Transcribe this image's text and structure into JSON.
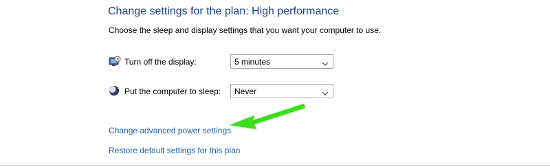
{
  "header": {
    "title": "Change settings for the plan: High performance",
    "subtitle": "Choose the sleep and display settings that you want your computer to use."
  },
  "settings": [
    {
      "icon": "monitor-clock-icon",
      "label": "Turn off the display:",
      "value": "5 minutes"
    },
    {
      "icon": "moon-sleep-icon",
      "label": "Put the computer to sleep:",
      "value": "Never"
    }
  ],
  "links": {
    "advanced": "Change advanced power settings",
    "restore": "Restore default settings for this plan"
  },
  "colors": {
    "title": "#1e3f8a",
    "link": "#1e5fa8",
    "arrow": "#3ddc1e"
  }
}
